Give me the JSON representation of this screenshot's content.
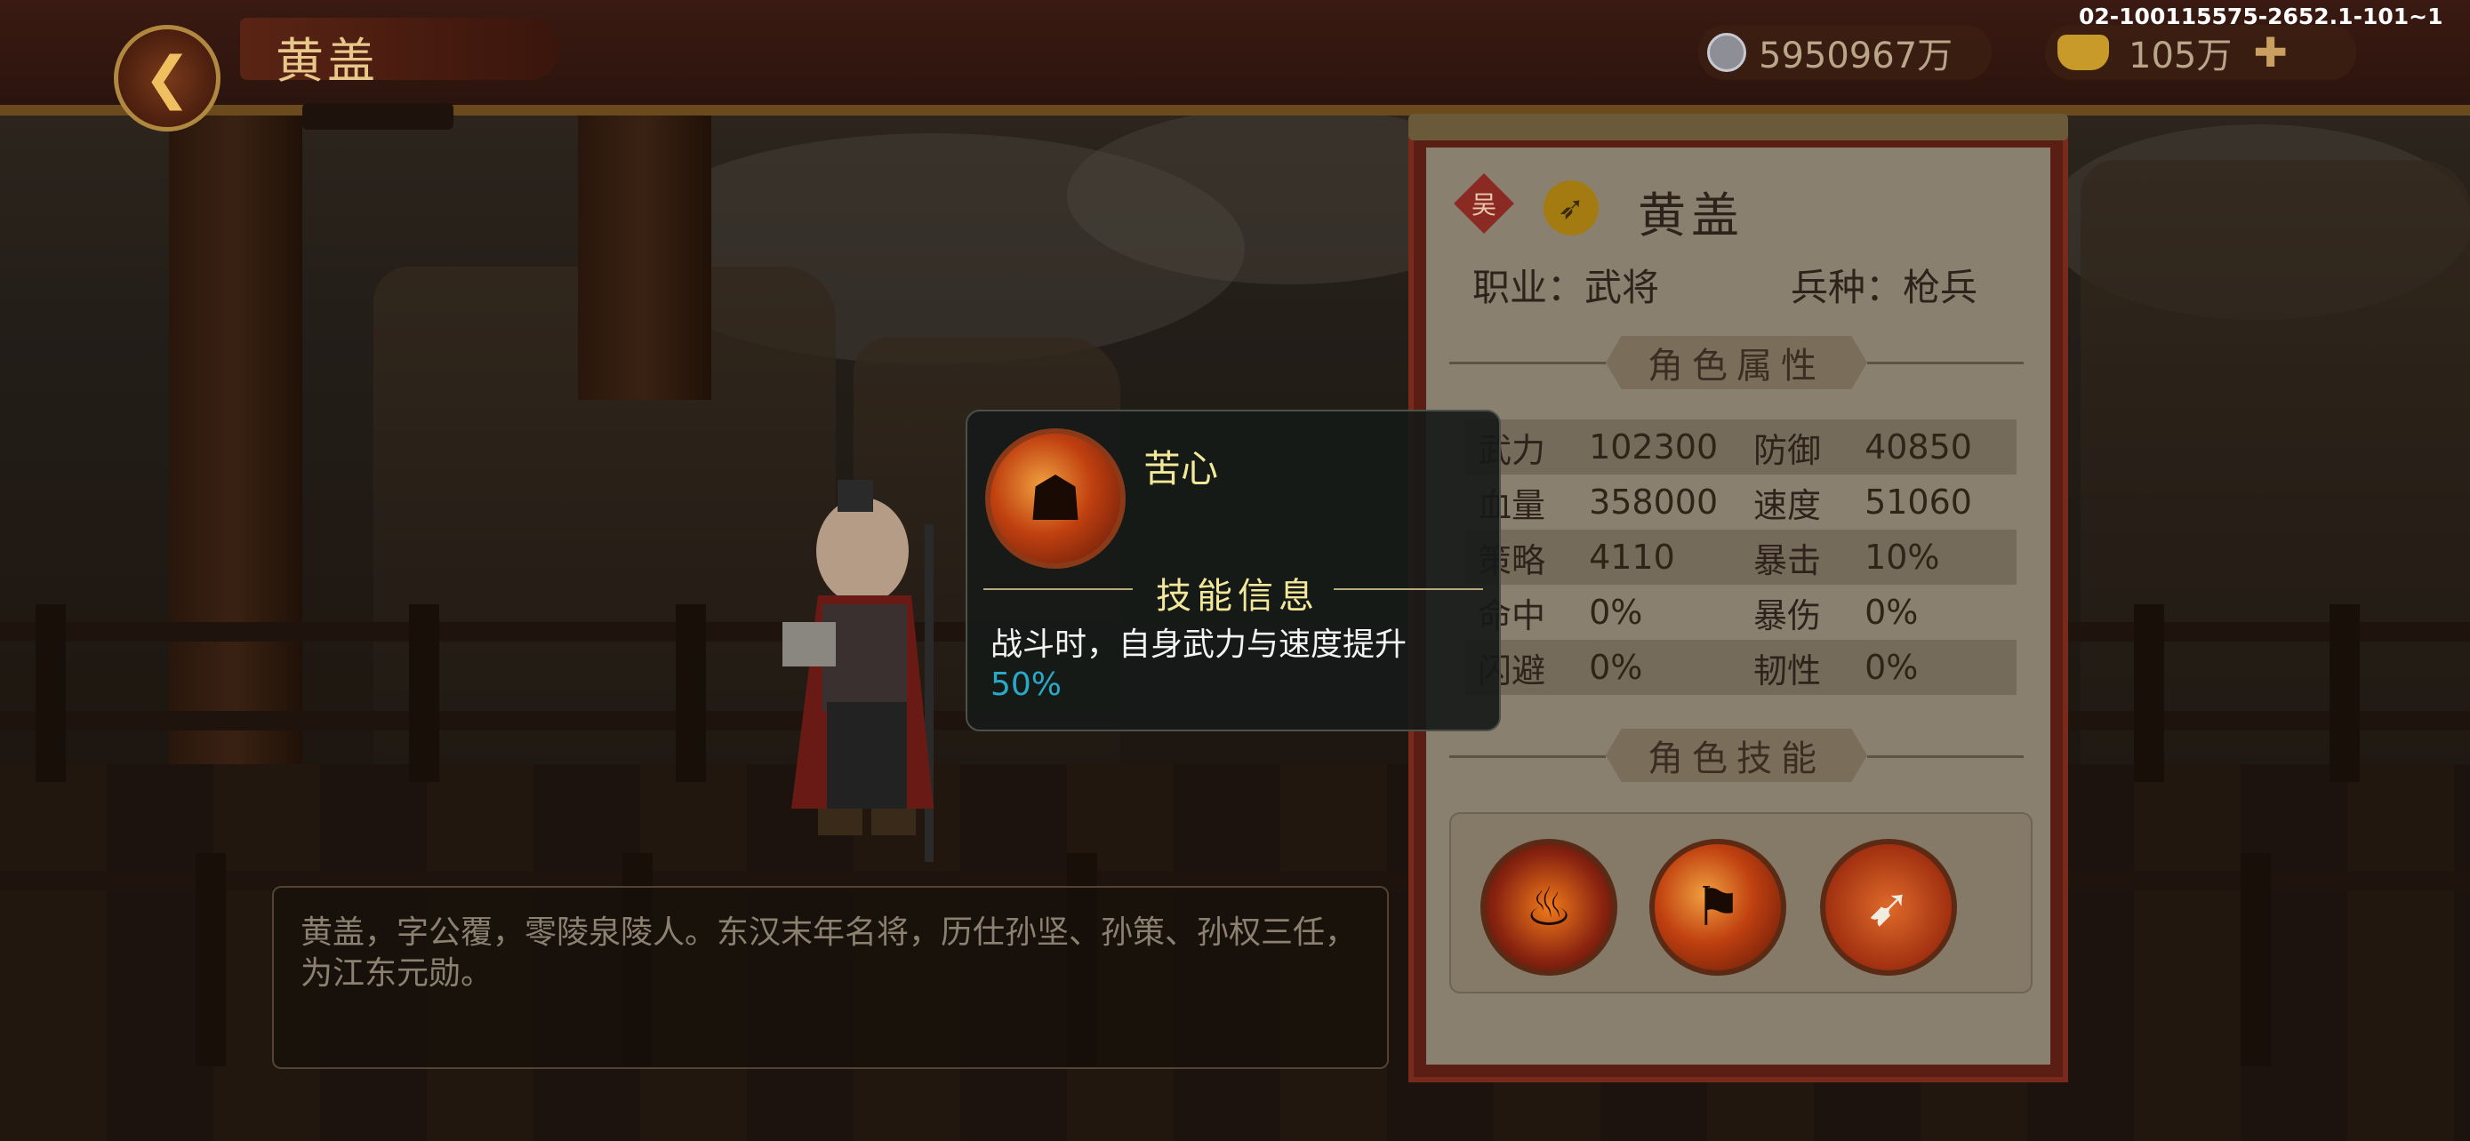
{
  "header": {
    "back_icon": "back-arrow-icon",
    "title": "黄盖"
  },
  "currency": {
    "silver_icon": "silver-coin-icon",
    "silver": "5950967万",
    "gold_icon": "gold-ingot-icon",
    "gold": "105万",
    "add_icon": "plus-icon",
    "add_label": "✚"
  },
  "build_id": "02-100115575-2652.1-101~1",
  "bio": {
    "text": "黄盖，字公覆，零陵泉陵人。东汉末年名将，历仕孙坚、孙策、孙权三任，为江东元勋。"
  },
  "panel": {
    "faction_badge": "吴",
    "class_icon": "spear-class-icon",
    "name": "黄盖",
    "job_label": "职业：武将",
    "troop_label": "兵种：枪兵",
    "attributes_heading": "角色属性",
    "stats": [
      {
        "l1": "武力",
        "v1": "102300",
        "l2": "防御",
        "v2": "40850"
      },
      {
        "l1": "血量",
        "v1": "358000",
        "l2": "速度",
        "v2": "51060"
      },
      {
        "l1": "策略",
        "v1": "4110",
        "l2": "暴击",
        "v2": "10%"
      },
      {
        "l1": "命中",
        "v1": "0%",
        "l2": "暴伤",
        "v2": "0%"
      },
      {
        "l1": "闪避",
        "v1": "0%",
        "l2": "韧性",
        "v2": "0%"
      }
    ],
    "skills_heading": "角色技能",
    "skills": [
      "fire-warrior-skill-icon",
      "flame-banner-skill-icon",
      "spear-thrust-skill-icon"
    ]
  },
  "tooltip": {
    "skill_icon": "skill-portrait-icon",
    "skill_name": "苦心",
    "heading": "技能信息",
    "desc": "战斗时，自身武力与速度提升",
    "value": "50%"
  }
}
